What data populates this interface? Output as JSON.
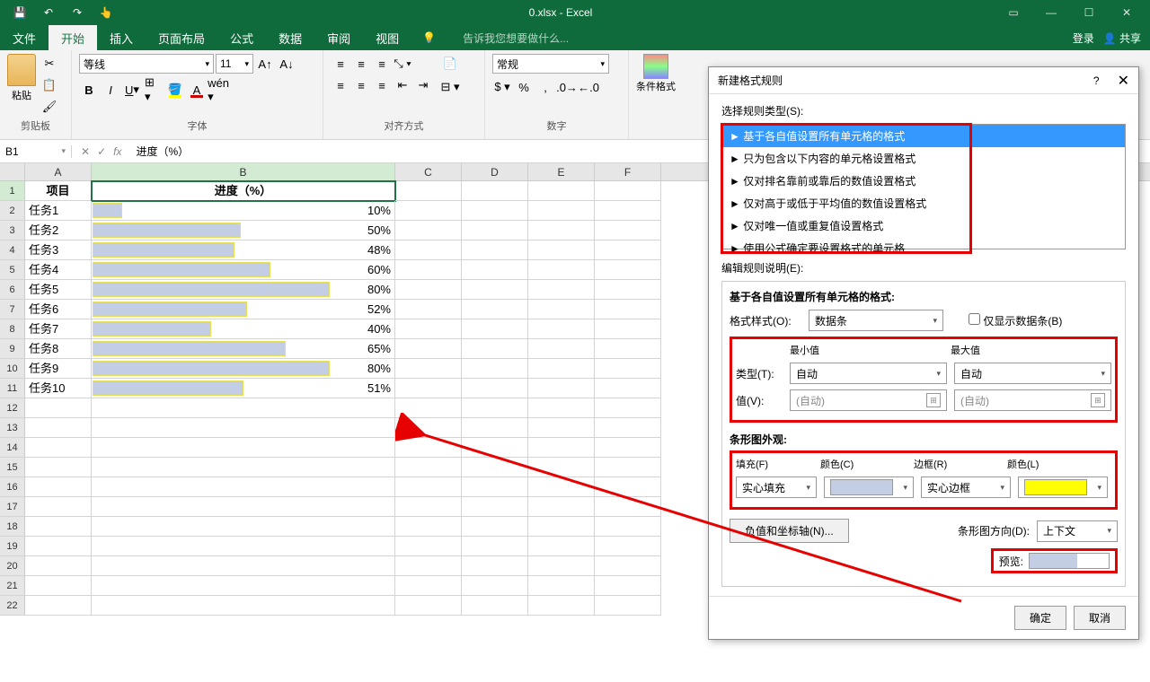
{
  "app": {
    "title": "0.xlsx - Excel",
    "tell_me": "告诉我您想要做什么...",
    "login": "登录",
    "share": "共享"
  },
  "menu": [
    "文件",
    "开始",
    "插入",
    "页面布局",
    "公式",
    "数据",
    "审阅",
    "视图"
  ],
  "ribbon": {
    "paste": "粘贴",
    "clipboard_label": "剪贴板",
    "font_name": "等线",
    "font_size": "11",
    "font_label": "字体",
    "align_label": "对齐方式",
    "number_format": "常规",
    "number_label": "数字",
    "cond_format": "条件格式"
  },
  "namebox": "B1",
  "formula": "进度（%）",
  "grid": {
    "cols": [
      "A",
      "B",
      "C",
      "D",
      "E",
      "F"
    ],
    "header_A": "项目",
    "header_B": "进度（%）",
    "rows": [
      {
        "proj": "任务1",
        "pct": 10
      },
      {
        "proj": "任务2",
        "pct": 50
      },
      {
        "proj": "任务3",
        "pct": 48
      },
      {
        "proj": "任务4",
        "pct": 60
      },
      {
        "proj": "任务5",
        "pct": 80
      },
      {
        "proj": "任务6",
        "pct": 52
      },
      {
        "proj": "任务7",
        "pct": 40
      },
      {
        "proj": "任务8",
        "pct": 65
      },
      {
        "proj": "任务9",
        "pct": 80
      },
      {
        "proj": "任务10",
        "pct": 51
      }
    ]
  },
  "dialog": {
    "title": "新建格式规则",
    "select_type_label": "选择规则类型(S):",
    "rule_types": [
      "基于各自值设置所有单元格的格式",
      "只为包含以下内容的单元格设置格式",
      "仅对排名靠前或靠后的数值设置格式",
      "仅对高于或低于平均值的数值设置格式",
      "仅对唯一值或重复值设置格式",
      "使用公式确定要设置格式的单元格"
    ],
    "edit_desc_label": "编辑规则说明(E):",
    "group_title": "基于各自值设置所有单元格的格式:",
    "format_style_label": "格式样式(O):",
    "format_style_value": "数据条",
    "show_bar_only": "仅显示数据条(B)",
    "min_label": "最小值",
    "max_label": "最大值",
    "type_label": "类型(T):",
    "type_min": "自动",
    "type_max": "自动",
    "value_label": "值(V):",
    "value_auto": "(自动)",
    "bar_appearance": "条形图外观:",
    "fill_label": "填充(F)",
    "color_label": "颜色(C)",
    "border_label": "边框(R)",
    "border_color_label": "颜色(L)",
    "fill_value": "实心填充",
    "border_value": "实心边框",
    "fill_color": "#c3cde4",
    "border_color": "#ffff00",
    "neg_axis_btn": "负值和坐标轴(N)...",
    "bar_dir_label": "条形图方向(D):",
    "bar_dir_value": "上下文",
    "preview_label": "预览:",
    "ok": "确定",
    "cancel": "取消"
  }
}
